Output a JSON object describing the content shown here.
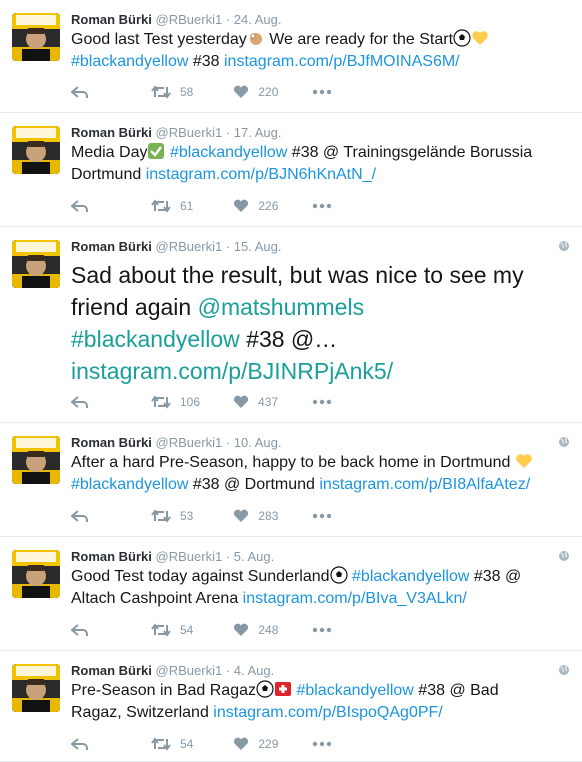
{
  "tweets": [
    {
      "name": "Roman Bürki",
      "handle": "@RBuerki1",
      "date": "· 24. Aug.",
      "text_parts": [
        "Good last Test yesterday",
        " We are ready for the Start"
      ],
      "hashtag": "#blackandyellow",
      "after_hashtag": " #38 ",
      "link": "instagram.com/p/BJfMOINAS6M/",
      "retweets": "58",
      "likes": "220"
    },
    {
      "name": "Roman Bürki",
      "handle": "@RBuerki1",
      "date": "· 17. Aug.",
      "text_parts": [
        "Media Day",
        " "
      ],
      "hashtag": "#blackandyellow",
      "after_hashtag": " #38 @ Trainingsgelände Borussia Dortmund ",
      "link": "instagram.com/p/BJN6hKnAtN_/",
      "retweets": "61",
      "likes": "226"
    },
    {
      "name": "Roman Bürki",
      "handle": "@RBuerki1",
      "date": "· 15. Aug.",
      "text_start": "Sad about the result, but was nice to see my friend again ",
      "mention": "@matshummels",
      "hashtag": "#blackandyellow",
      "after_hashtag": " #38 @…",
      "link": "instagram.com/p/BJINRPjAnk5/",
      "retweets": "106",
      "likes": "437"
    },
    {
      "name": "Roman Bürki",
      "handle": "@RBuerki1",
      "date": "· 10. Aug.",
      "text_start": "After a hard Pre-Season, happy to be back home in Dortmund ",
      "hashtag": "#blackandyellow",
      "after_hashtag": " #38 @ Dortmund ",
      "link": "instagram.com/p/BI8AlfaAtez/",
      "retweets": "53",
      "likes": "283"
    },
    {
      "name": "Roman Bürki",
      "handle": "@RBuerki1",
      "date": "· 5. Aug.",
      "text_start": "Good Test today against Sunderland",
      "hashtag": "#blackandyellow",
      "after_hashtag": " #38 @ Altach Cashpoint Arena ",
      "link": "instagram.com/p/BIva_V3ALkn/",
      "retweets": "54",
      "likes": "248"
    },
    {
      "name": "Roman Bürki",
      "handle": "@RBuerki1",
      "date": "· 4. Aug.",
      "text_start": "Pre-Season in Bad Ragaz",
      "hashtag": "#blackandyellow",
      "after_hashtag": " #38 @ Bad Ragaz, Switzerland ",
      "link": "instagram.com/p/BIspoQAg0PF/",
      "retweets": "54",
      "likes": "229"
    }
  ],
  "icons": {
    "reply": "reply-icon",
    "retweet": "retweet-icon",
    "like": "heart-icon",
    "more": "more-icon",
    "globe": "globe-icon"
  },
  "colors": {
    "link": "#1b95e0",
    "meta": "#8899a6",
    "divider": "#e6ecf0"
  }
}
